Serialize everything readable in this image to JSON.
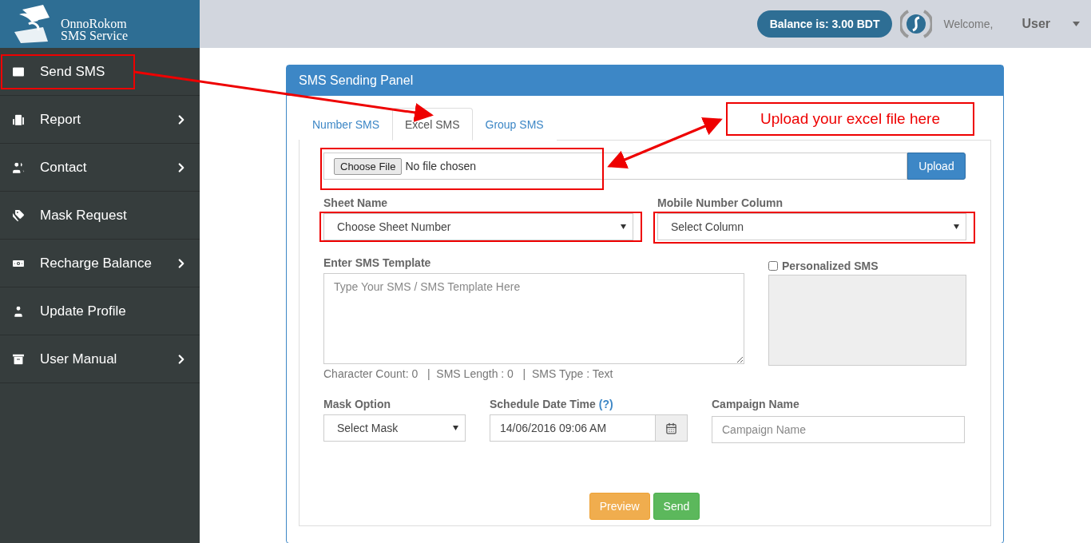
{
  "logo": {
    "lines": [
      "OnnoRokom",
      "SMS Service"
    ]
  },
  "header": {
    "balance": "Balance is: 3.00 BDT",
    "welcome": "Welcome,",
    "user": "User"
  },
  "sidebar": {
    "items": [
      {
        "label": "Send SMS",
        "has_submenu": false
      },
      {
        "label": "Report",
        "has_submenu": true
      },
      {
        "label": "Contact",
        "has_submenu": true
      },
      {
        "label": "Mask Request",
        "has_submenu": false
      },
      {
        "label": "Recharge Balance",
        "has_submenu": true
      },
      {
        "label": "Update Profile",
        "has_submenu": false
      },
      {
        "label": "User Manual",
        "has_submenu": true
      }
    ]
  },
  "panel": {
    "title": "SMS Sending Panel",
    "tabs": [
      {
        "label": "Number SMS",
        "selected": false
      },
      {
        "label": "Excel SMS",
        "selected": true
      },
      {
        "label": "Group SMS",
        "selected": false
      }
    ],
    "file_input": {
      "button": "Choose File",
      "status": "No file chosen"
    },
    "upload_button": "Upload",
    "sheet_name": {
      "label": "Sheet Name",
      "value": "Choose Sheet Number"
    },
    "mobile_column": {
      "label": "Mobile Number Column",
      "value": "Select Column"
    },
    "template": {
      "label": "Enter SMS Template",
      "placeholder": "Type Your SMS / SMS Template Here"
    },
    "personalized": {
      "label": "Personalized SMS",
      "checked": false
    },
    "counter": "Character Count: 0   |  SMS Length : 0   |  SMS Type : Text",
    "mask": {
      "label": "Mask Option",
      "value": "Select Mask"
    },
    "schedule": {
      "label": "Schedule Date Time",
      "help": "(?)",
      "value": "14/06/2016 09:06 AM"
    },
    "campaign": {
      "label": "Campaign Name",
      "placeholder": "Campaign Name"
    },
    "buttons": [
      {
        "label": "Preview",
        "kind": "warning"
      },
      {
        "label": "Send",
        "kind": "success"
      }
    ]
  },
  "annotation": {
    "callout": "Upload your excel file here"
  }
}
